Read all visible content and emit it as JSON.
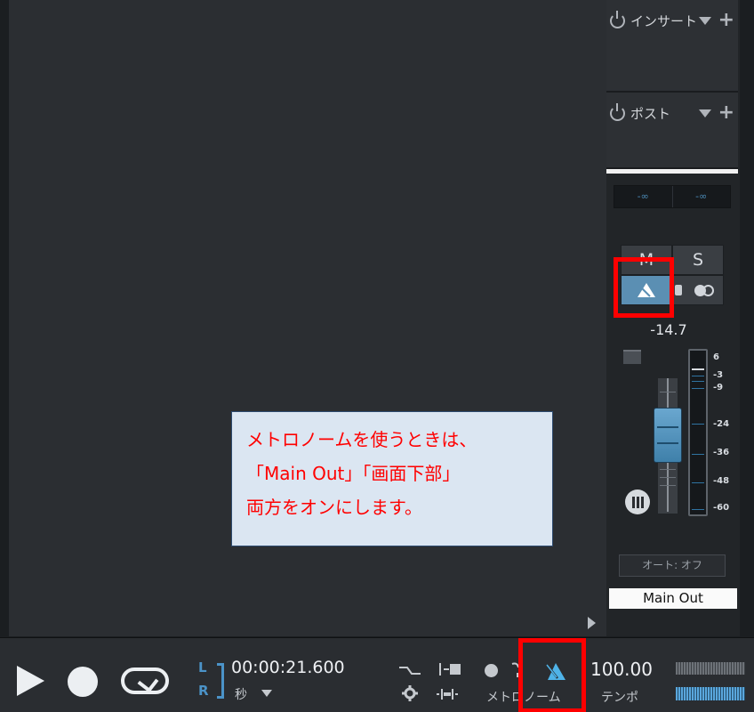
{
  "strip": {
    "insert_label": "インサート",
    "post_label": "ポスト",
    "pan_left": "-∞",
    "pan_right": "-∞",
    "mute_label": "M",
    "solo_label": "S",
    "volume": "-14.7",
    "meter_scale": [
      "6",
      "-3",
      "-9",
      "-24",
      "-36",
      "-48",
      "-60"
    ],
    "auto_label": "オート: オフ",
    "channel_name": "Main Out"
  },
  "transport": {
    "lr_left": "L",
    "lr_right": "R",
    "time": "00:00:21.600",
    "time_unit": "秒",
    "metronome_label": "メトロノーム",
    "tempo_value": "100.00",
    "tempo_label": "テンポ"
  },
  "callout": {
    "line1": "メトロノームを使うときは、",
    "line2": "「Main Out」「画面下部」",
    "line3": "両方をオンにします。"
  },
  "colors": {
    "accent_blue": "#5b8fb3",
    "highlight_red": "#ff0000",
    "callout_bg": "#dbe6f2"
  }
}
